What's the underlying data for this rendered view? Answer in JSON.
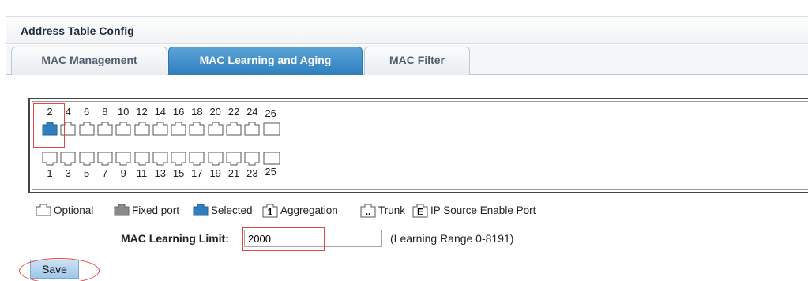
{
  "page_title": "Address Table Config",
  "tabs": [
    {
      "label": "MAC Management",
      "active": false
    },
    {
      "label": "MAC Learning and Aging",
      "active": true
    },
    {
      "label": "MAC Filter",
      "active": false
    }
  ],
  "switch_panel": {
    "top_ports": [
      "2",
      "4",
      "6",
      "8",
      "10",
      "12",
      "14",
      "16",
      "18",
      "20",
      "22",
      "24"
    ],
    "bottom_ports": [
      "1",
      "3",
      "5",
      "7",
      "9",
      "11",
      "13",
      "15",
      "17",
      "19",
      "21",
      "23"
    ],
    "top_sfp": "26",
    "bottom_sfp": "25",
    "selected_port": "2"
  },
  "legend": {
    "optional": "Optional",
    "fixed": "Fixed port",
    "selected": "Selected",
    "aggregation": "Aggregation",
    "aggregation_glyph": "1",
    "trunk": "Trunk",
    "trunk_glyph": "..",
    "ip_source": "IP Source Enable Port",
    "ip_source_glyph": "E"
  },
  "form": {
    "limit_label": "MAC Learning Limit:",
    "limit_value": "2000",
    "range_hint": "(Learning Range 0-8191)"
  },
  "actions": {
    "save_label": "Save"
  },
  "colors": {
    "tab_active": "#3a8bc8",
    "port_selected": "#2f7fc0",
    "port_fixed": "#8a8a8a",
    "highlight": "#e04848"
  }
}
